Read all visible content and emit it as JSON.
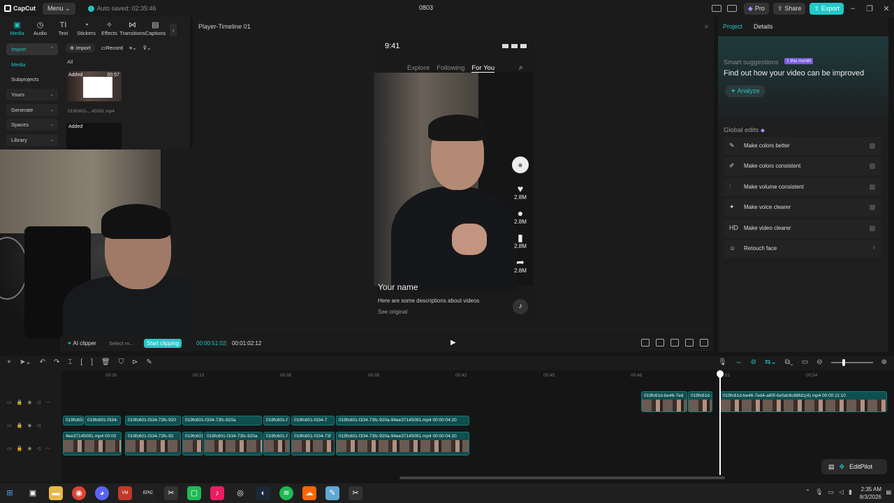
{
  "app": {
    "logo_text": "CapCut",
    "menu_label": "Menu",
    "autosave_text": "Auto saved: 02:35:46",
    "project_title": "0803",
    "pro_label": "Pro",
    "share_label": "Share",
    "export_label": "Export",
    "accent_color": "#22c3c3"
  },
  "left_panel": {
    "tabs": [
      "Media",
      "Audio",
      "Text",
      "Stickers",
      "Effects",
      "Transitions",
      "Captions"
    ],
    "nav": {
      "import": "Import",
      "media": "Media",
      "subprojects": "Subprojects",
      "yours": "Yours",
      "generate": "Generate",
      "spaces": "Spaces",
      "library": "Library"
    },
    "toolbar": {
      "import_label": "Import",
      "record_label": "Record"
    },
    "filter_all": "All",
    "thumbs": [
      {
        "badge": "Added",
        "duration": "00:57",
        "filename": "019fc601-...45091.mp4"
      },
      {
        "badge": "Added"
      }
    ]
  },
  "player": {
    "title": "Player-Timeline 01",
    "phone": {
      "time": "9:41",
      "nav": [
        "Explore",
        "Following",
        "For You"
      ],
      "counts": [
        "2.8M",
        "2.8M",
        "2.8M",
        "2.8M"
      ],
      "name": "Your name",
      "description": "Here are some descriptions about videos",
      "see_original": "See original"
    },
    "ai_clipper": "AI clipper",
    "select_placeholder": "Select m...",
    "start_clipping": "Start clipping",
    "current_time": "00:00:51:02",
    "total_time": "00:01:02:12"
  },
  "right_panel": {
    "tabs": [
      "Project",
      "Details"
    ],
    "smart_suggestions": "Smart suggestions",
    "badge": "1 this month",
    "find_out": "Find out how your video can be improved",
    "analyze": "Analyze",
    "global_edits": "Global edits",
    "edits": [
      {
        "icon": "✎",
        "label": "Make colors better"
      },
      {
        "icon": "✐",
        "label": "Make colors consistent"
      },
      {
        "icon": "⫶",
        "label": "Make volume consistent"
      },
      {
        "icon": "✦",
        "label": "Make voice clearer"
      },
      {
        "icon": "HD",
        "label": "Make video clearer"
      },
      {
        "icon": "☺",
        "label": "Retouch face"
      }
    ]
  },
  "timeline": {
    "ruler": [
      "00:30",
      "00:33",
      "00:36",
      "00:39",
      "00:42",
      "00:45",
      "00:48",
      "00:51",
      "00:54"
    ],
    "clips_top": [
      {
        "name": "019fc61d-be46-7ed",
        "duration": ""
      },
      {
        "name": "019fc61d-",
        "duration": ""
      },
      {
        "name": "019fc61d-be46-7ed4-a65f-6e5dc6c68fd1(4).mp4",
        "duration": "00:00:11:10"
      }
    ],
    "clips_mid": [
      {
        "name": "019fc601",
        "duration": ""
      },
      {
        "name": "019fc601-f334-",
        "duration": ""
      },
      {
        "name": "019fc601-f334-73fc-920",
        "duration": ""
      },
      {
        "name": "019fc601-f334-73fc-920a",
        "duration": ""
      },
      {
        "name": "019fc601-f",
        "duration": ""
      },
      {
        "name": "019fc601-f334-7",
        "duration": ""
      },
      {
        "name": "019fc601-f334-73fc-920a-94ee37145091.mp4",
        "duration": "00:00:04:20"
      }
    ],
    "clips_bottom": [
      {
        "name": "4ee37145091.mp4",
        "duration": "00:00"
      },
      {
        "name": "019fc601-f334-73fc-92",
        "duration": ""
      },
      {
        "name": "019fc601",
        "duration": ""
      },
      {
        "name": "019fc601-f334-73fc-920a",
        "duration": ""
      },
      {
        "name": "019fc601-f",
        "duration": ""
      },
      {
        "name": "019fc601-f334-73f",
        "duration": ""
      },
      {
        "name": "019fc601-f334-73fc-920a-94ee37145091.mp4",
        "duration": "00:00:04:20"
      }
    ],
    "editpilot": "EditPilot"
  },
  "taskbar": {
    "time": "2:35 AM",
    "date": "8/3/2026"
  }
}
